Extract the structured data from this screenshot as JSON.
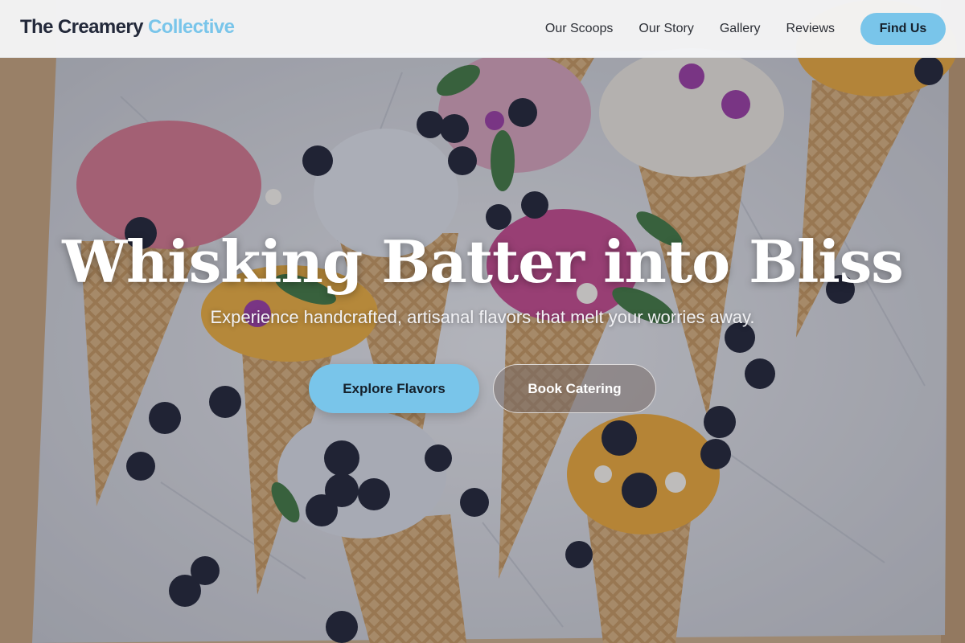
{
  "header": {
    "brand_main": "The Creamery",
    "brand_accent": "Collective",
    "nav_links": [
      "Our Scoops",
      "Our Story",
      "Gallery",
      "Reviews"
    ],
    "cta_label": "Find Us"
  },
  "hero": {
    "title": "Whisking Batter into Bliss",
    "subtitle": "Experience handcrafted, artisanal flavors that melt your worries away.",
    "primary_button": "Explore Flavors",
    "secondary_button": "Book Catering",
    "background_icon": "ice-cream-cones-photo"
  },
  "colors": {
    "accent": "#79c5ea",
    "brand_dark": "#23293a"
  }
}
